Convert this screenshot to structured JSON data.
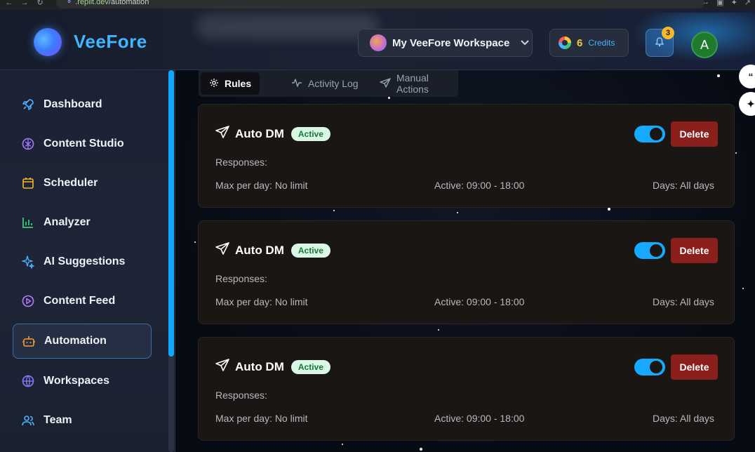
{
  "browser": {
    "url_host": ".replit.dev",
    "url_path": "/automation"
  },
  "header": {
    "brand": "VeeFore",
    "workspace_label": "My VeeFore Workspace",
    "credits_count": "6",
    "credits_label": "Credits",
    "notification_count": "3",
    "user_initial": "A"
  },
  "sidebar": {
    "items": [
      {
        "label": "Dashboard",
        "icon": "rocket-icon"
      },
      {
        "label": "Content Studio",
        "icon": "brain-icon"
      },
      {
        "label": "Scheduler",
        "icon": "calendar-icon"
      },
      {
        "label": "Analyzer",
        "icon": "bar-chart-icon"
      },
      {
        "label": "AI Suggestions",
        "icon": "sparkles-icon"
      },
      {
        "label": "Content Feed",
        "icon": "play-circle-icon"
      },
      {
        "label": "Automation",
        "icon": "bot-icon",
        "active": true
      },
      {
        "label": "Workspaces",
        "icon": "globe-icon"
      },
      {
        "label": "Team",
        "icon": "users-icon"
      }
    ]
  },
  "tabs": [
    {
      "label": "Rules",
      "icon": "gear-icon",
      "active": true
    },
    {
      "label": "Activity Log",
      "icon": "activity-icon"
    },
    {
      "label": "Manual Actions",
      "icon": "send-icon"
    }
  ],
  "rules": [
    {
      "title": "Auto DM",
      "status": "Active",
      "enabled": true,
      "delete_label": "Delete",
      "responses_label": "Responses:",
      "max_per_day": "Max per day: No limit",
      "active_hours": "Active: 09:00 - 18:00",
      "days": "Days: All days"
    },
    {
      "title": "Auto DM",
      "status": "Active",
      "enabled": true,
      "delete_label": "Delete",
      "responses_label": "Responses:",
      "max_per_day": "Max per day: No limit",
      "active_hours": "Active: 09:00 - 18:00",
      "days": "Days: All days"
    },
    {
      "title": "Auto DM",
      "status": "Active",
      "enabled": true,
      "delete_label": "Delete",
      "responses_label": "Responses:",
      "max_per_day": "Max per day: No limit",
      "active_hours": "Active: 09:00 - 18:00",
      "days": "Days: All days"
    }
  ],
  "colors": {
    "accent": "#17a9ff",
    "brand_text": "#3fb6ff",
    "delete_bg": "#8a1f1c",
    "active_badge_bg": "#d9f7e4",
    "active_badge_text": "#157a3a",
    "credits_count": "#f4c542"
  }
}
